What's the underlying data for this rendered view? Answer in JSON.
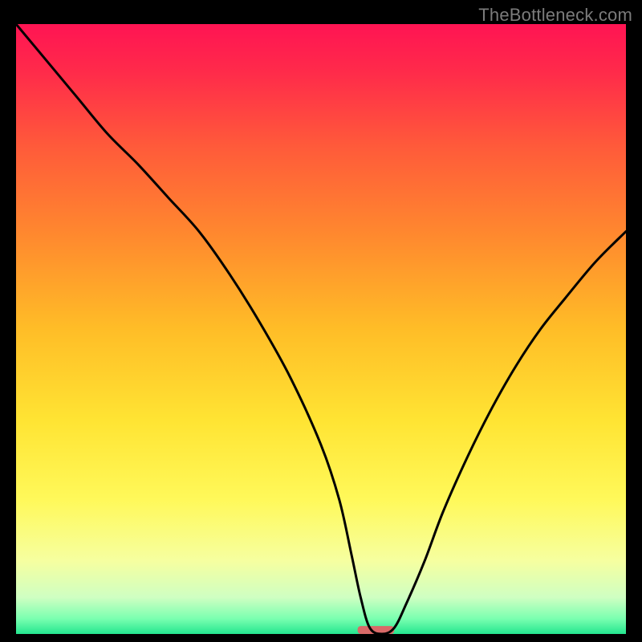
{
  "watermark": "TheBottleneck.com",
  "chart_data": {
    "type": "line",
    "title": "",
    "xlabel": "",
    "ylabel": "",
    "xlim": [
      0,
      100
    ],
    "ylim": [
      0,
      100
    ],
    "background_gradient_stops": [
      {
        "pos": 0.0,
        "color": "#ff1453"
      },
      {
        "pos": 0.08,
        "color": "#ff2b4a"
      },
      {
        "pos": 0.2,
        "color": "#ff5a3a"
      },
      {
        "pos": 0.35,
        "color": "#ff8a2e"
      },
      {
        "pos": 0.5,
        "color": "#ffbd27"
      },
      {
        "pos": 0.65,
        "color": "#ffe433"
      },
      {
        "pos": 0.78,
        "color": "#fff95a"
      },
      {
        "pos": 0.88,
        "color": "#f6ffa0"
      },
      {
        "pos": 0.94,
        "color": "#cfffc2"
      },
      {
        "pos": 0.975,
        "color": "#7affb0"
      },
      {
        "pos": 1.0,
        "color": "#24e68f"
      }
    ],
    "curve": {
      "x": [
        0,
        5,
        10,
        15,
        20,
        25,
        30,
        35,
        40,
        45,
        50,
        53,
        55,
        56.5,
        58,
        60,
        62,
        64,
        67,
        70,
        74,
        78,
        82,
        86,
        90,
        95,
        100
      ],
      "y": [
        100,
        94,
        88,
        82,
        77,
        71.5,
        66,
        59,
        51,
        42,
        31,
        22,
        13,
        6,
        1,
        0,
        1,
        5,
        12,
        20,
        29,
        37,
        44,
        50,
        55,
        61,
        66
      ]
    },
    "marker": {
      "x": 59,
      "y": 0,
      "width": 6,
      "height": 1.3,
      "color": "#d96a68"
    }
  }
}
